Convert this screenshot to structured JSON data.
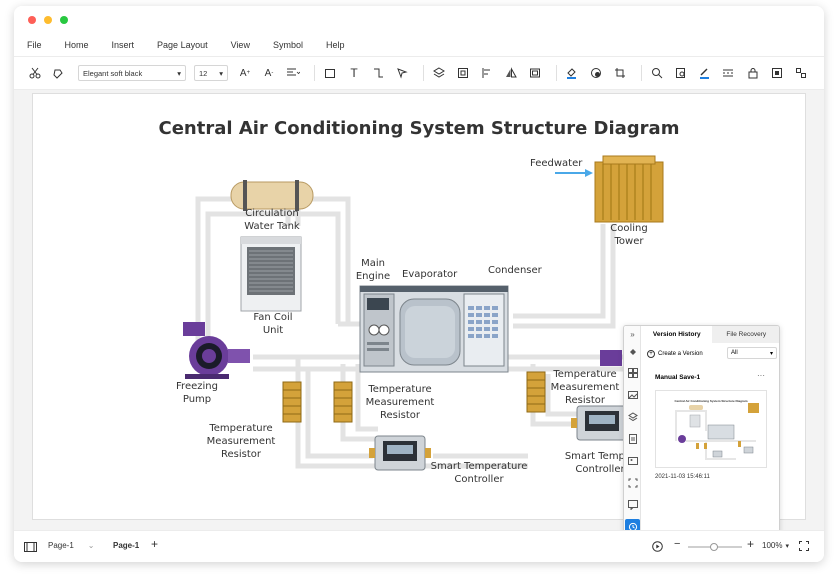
{
  "menu": [
    "File",
    "Home",
    "Insert",
    "Page Layout",
    "View",
    "Symbol",
    "Help"
  ],
  "toolbar": {
    "font_name": "Elegant soft black",
    "font_size": "12"
  },
  "diagram": {
    "title": "Central Air Conditioning System Structure Diagram",
    "labels": {
      "feedwater": "Feedwater",
      "circulation_tank_1": "Circulation",
      "circulation_tank_2": "Water Tank",
      "fan_coil_1": "Fan Coil",
      "fan_coil_2": "Unit",
      "main_engine_1": "Main",
      "main_engine_2": "Engine",
      "evaporator": "Evaporator",
      "condenser": "Condenser",
      "cooling_tower_1": "Cooling",
      "cooling_tower_2": "Tower",
      "freezing_pump_1": "Freezing",
      "freezing_pump_2": "Pump",
      "temp_resistor_left_1": "Temperature",
      "temp_resistor_left_2": "Measurement",
      "temp_resistor_left_3": "Resistor",
      "temp_resistor_mid_1": "Temperature",
      "temp_resistor_mid_2": "Measurement",
      "temp_resistor_mid_3": "Resistor",
      "temp_resistor_right_1": "Temperature",
      "temp_resistor_right_2": "Measurement",
      "temp_resistor_right_3": "Resistor",
      "smart_ctrl_1": "Smart Temperature",
      "smart_ctrl_2": "Controller",
      "smart_ctrl_right_1": "Smart Temper",
      "smart_ctrl_right_2": "Controller"
    }
  },
  "version_panel": {
    "tab_history": "Version History",
    "tab_recovery": "File Recovery",
    "create_version": "Create a Version",
    "filter": "All",
    "version_title": "Manual Save-1",
    "more": "···",
    "thumb_title": "Central Air Conditioning System Structure Diagram",
    "timestamp": "2021-11-03 15:46:11"
  },
  "status": {
    "page_selector": "Page-1",
    "page_tab": "Page-1",
    "zoom": "100%"
  },
  "colors": {
    "accent": "#1e7fe0",
    "pipe": "#e3e3e3",
    "pump": "#6a3d9a",
    "tower": "#d4a23a"
  }
}
